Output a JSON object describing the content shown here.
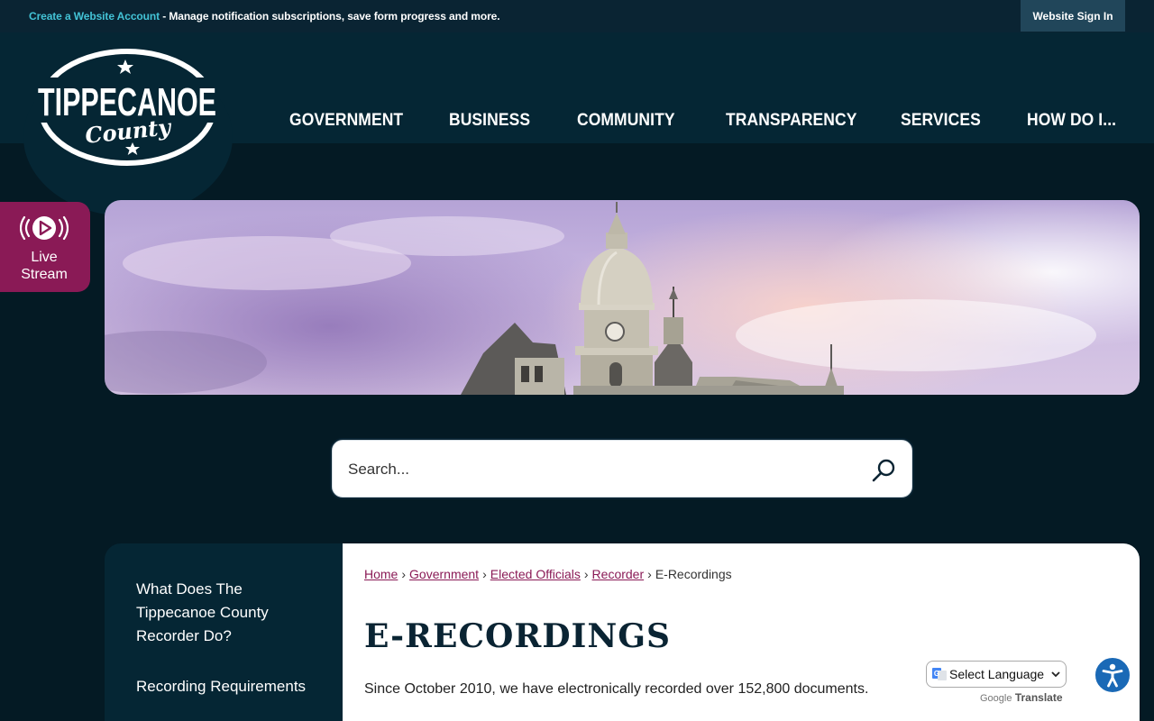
{
  "topbar": {
    "create_account_link": "Create a Website Account",
    "message": " - Manage notification subscriptions, save form progress and more.",
    "signin_label": "Website Sign In"
  },
  "logo": {
    "name": "TIPPECANOE",
    "sub": "County"
  },
  "nav": {
    "items": [
      "GOVERNMENT",
      "BUSINESS",
      "COMMUNITY",
      "TRANSPARENCY",
      "SERVICES",
      "HOW DO I..."
    ]
  },
  "live_stream": {
    "line1": "Live",
    "line2": "Stream",
    "icon": "live-stream-play-icon"
  },
  "search": {
    "placeholder": "Search...",
    "icon": "search-icon"
  },
  "sidenav": {
    "items": [
      "What Does The Tippecanoe County Recorder Do?",
      "Recording Requirements"
    ]
  },
  "breadcrumb": {
    "links": [
      "Home",
      "Government",
      "Elected Officials",
      "Recorder"
    ],
    "current": "E-Recordings",
    "separator": "›"
  },
  "main": {
    "title": "E-RECORDINGS",
    "intro": "Since October 2010, we have electronically recorded over 152,800 documents."
  },
  "translate": {
    "select_label": "Select Language",
    "powered_prefix": "Google",
    "powered_suffix": "Translate"
  },
  "colors": {
    "header": "#052634",
    "accent_link": "#43c3d6",
    "live_stream": "#8a1a56",
    "breadcrumb_link": "#8a1a56",
    "title": "#0a2433",
    "accessibility": "#1a69b6"
  }
}
